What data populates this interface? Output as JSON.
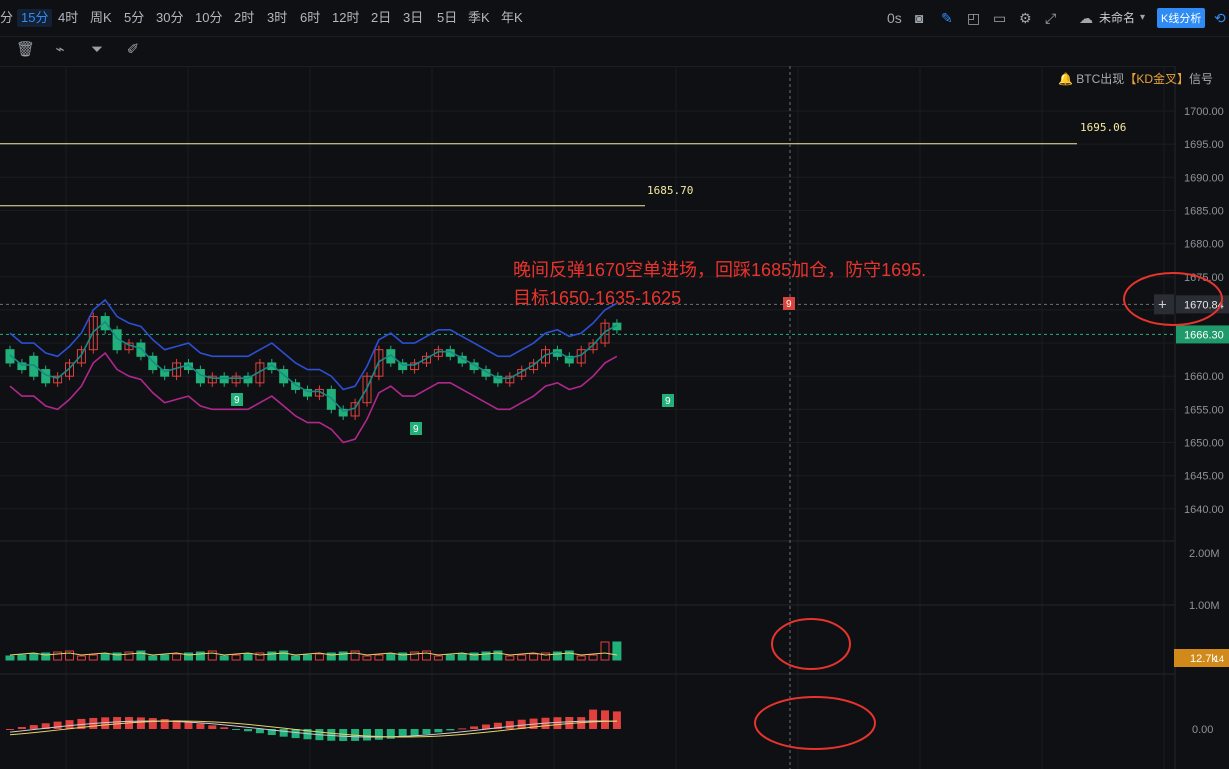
{
  "timeframes": [
    "分",
    "15分",
    "4时",
    "周K",
    "5分",
    "30分",
    "10分",
    "2时",
    "3时",
    "6时",
    "12时",
    "2日",
    "3日",
    "5日",
    "季K",
    "年K"
  ],
  "active_timeframe": "15分",
  "right_toolbar": {
    "countdown": "0s",
    "layout_name": "未命名",
    "analysis_button": "K线分析"
  },
  "signal": {
    "prefix": "BTC出现",
    "highlight": "【KD金叉】",
    "suffix": "信号"
  },
  "annotation": {
    "line1": "晚间反弹1670空单进场，回踩1685加仓，防守1695.",
    "line2": "目标1650-1635-1625"
  },
  "price_lines": [
    {
      "label": "1695.06",
      "value": 1695.06
    },
    {
      "label": "1685.70",
      "value": 1685.7
    }
  ],
  "price_axis": [
    "1700.00",
    "1695.00",
    "1690.00",
    "1685.00",
    "1680.00",
    "1675.00",
    "1660.00",
    "1655.00",
    "1650.00",
    "1645.00",
    "1640.00"
  ],
  "crosshair_price": "1670.84",
  "current_price": "1666.30",
  "volume_axis": [
    "2.00M",
    "1.00M"
  ],
  "volume_value": "12.7k",
  "volume_value2": "14",
  "macd_axis": [
    "0.00"
  ],
  "td_labels": [
    "9",
    "9",
    "9",
    "9"
  ],
  "colors": {
    "up": "#e0413f",
    "down": "#21b07a",
    "ma_blue": "#2c4fd4",
    "ma_teal": "#178a86",
    "ma_purple": "#b0278e",
    "price_line": "#f3e9a2",
    "annot": "#e8342d",
    "accent": "#2f8cf5"
  },
  "chart_data": {
    "type": "candlestick",
    "candles": [
      [
        1664,
        1662
      ],
      [
        1662,
        1661
      ],
      [
        1663,
        1660
      ],
      [
        1661,
        1659
      ],
      [
        1659,
        1660
      ],
      [
        1660,
        1662
      ],
      [
        1662,
        1664
      ],
      [
        1664,
        1669
      ],
      [
        1669,
        1667
      ],
      [
        1667,
        1664
      ],
      [
        1664,
        1665
      ],
      [
        1665,
        1663
      ],
      [
        1663,
        1661
      ],
      [
        1661,
        1660
      ],
      [
        1660,
        1662
      ],
      [
        1662,
        1661
      ],
      [
        1661,
        1659
      ],
      [
        1659,
        1660
      ],
      [
        1660,
        1659
      ],
      [
        1659,
        1660
      ],
      [
        1660,
        1659
      ],
      [
        1659,
        1662
      ],
      [
        1662,
        1661
      ],
      [
        1661,
        1659
      ],
      [
        1659,
        1658
      ],
      [
        1658,
        1657
      ],
      [
        1657,
        1658
      ],
      [
        1658,
        1655
      ],
      [
        1655,
        1654
      ],
      [
        1654,
        1656
      ],
      [
        1656,
        1660
      ],
      [
        1660,
        1664
      ],
      [
        1664,
        1662
      ],
      [
        1662,
        1661
      ],
      [
        1661,
        1662
      ],
      [
        1662,
        1663
      ],
      [
        1663,
        1664
      ],
      [
        1664,
        1663
      ],
      [
        1663,
        1662
      ],
      [
        1662,
        1661
      ],
      [
        1661,
        1660
      ],
      [
        1660,
        1659
      ],
      [
        1659,
        1660
      ],
      [
        1660,
        1661
      ],
      [
        1661,
        1662
      ],
      [
        1662,
        1664
      ],
      [
        1664,
        1663
      ],
      [
        1663,
        1662
      ],
      [
        1662,
        1664
      ],
      [
        1664,
        1665
      ],
      [
        1665,
        1668
      ],
      [
        1668,
        1667
      ]
    ],
    "volume_axis": [
      "2.00M",
      "1.00M"
    ],
    "macd_axis": [
      "0.00"
    ]
  }
}
